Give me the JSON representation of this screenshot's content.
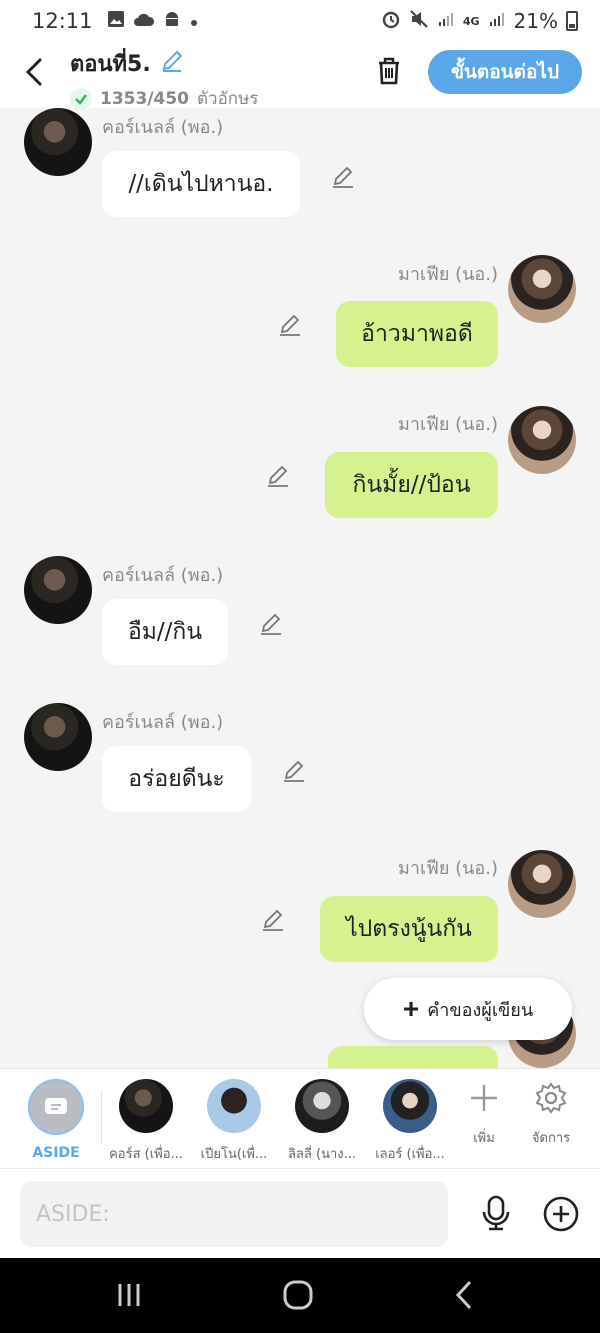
{
  "status_bar": {
    "time": "12:11",
    "network": "4G",
    "battery": "21%"
  },
  "header": {
    "title": "ตอนที่5.",
    "char_count": "1353/450",
    "char_unit": "ตัวอักษร",
    "next_button": "ขั้นตอนต่อไป"
  },
  "messages": [
    {
      "side": "left",
      "name": "คอร์เนลล์ (พอ.)",
      "text": "//เดินไปหานอ."
    },
    {
      "side": "right",
      "name": "มาเฟีย (นอ.)",
      "text": "อ้าวมาพอดี"
    },
    {
      "side": "right",
      "name": "มาเฟีย (นอ.)",
      "text": "กินมั้ย//ป้อน"
    },
    {
      "side": "left",
      "name": "คอร์เนลล์ (พอ.)",
      "text": "อืม//กิน"
    },
    {
      "side": "left",
      "name": "คอร์เนลล์ (พอ.)",
      "text": "อร่อยดีนะ"
    },
    {
      "side": "right",
      "name": "มาเฟีย (นอ.)",
      "text": "ไปตรงนู้นกัน"
    }
  ],
  "fab": {
    "label": "คำของผู้เขียน"
  },
  "characters": [
    {
      "label": "ASIDE"
    },
    {
      "label": "คอร์ส (เพื่อ..."
    },
    {
      "label": "เปียโน(เพื่..."
    },
    {
      "label": "ลิลลี่ (นาง..."
    },
    {
      "label": "เลอร์ (เพื่อ..."
    }
  ],
  "tools": {
    "add_label": "เพิ่ม",
    "manage_label": "จัดการ"
  },
  "input": {
    "placeholder": "ASIDE:"
  },
  "colors": {
    "accent": "#5aa8ea",
    "right_bubble": "#d5f28f",
    "left_bubble": "#ffffff",
    "background": "#f4f4f5"
  }
}
